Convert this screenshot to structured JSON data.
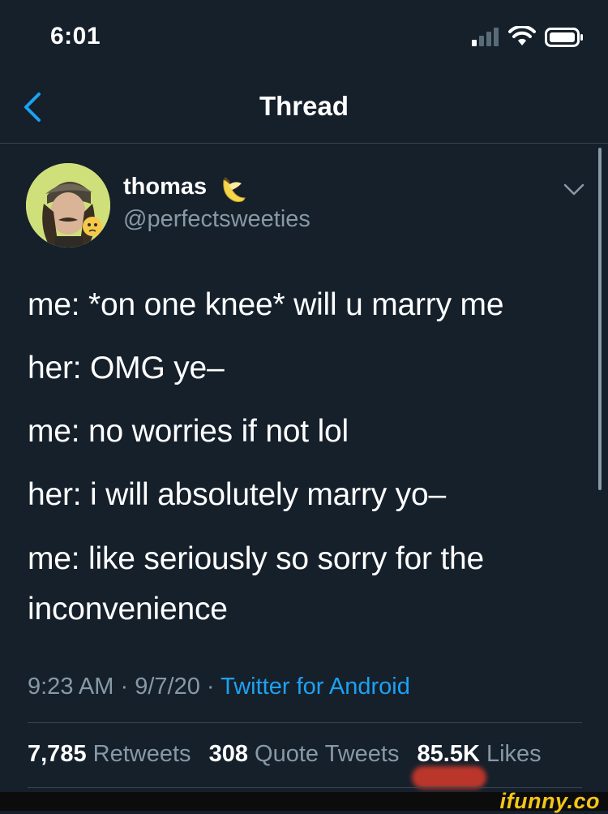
{
  "status_bar": {
    "time": "6:01",
    "icons": [
      "cellular-signal-icon",
      "wifi-icon",
      "battery-icon"
    ]
  },
  "nav": {
    "title": "Thread",
    "back_icon": "chevron-left-icon"
  },
  "tweet": {
    "author": {
      "display_name": "thomas",
      "emoji": "banana",
      "handle": "@perfectsweeties"
    },
    "text_lines": [
      "me: *on one knee* will u marry me",
      "her: OMG ye–",
      "me: no worries if not lol",
      "her: i will absolutely marry yo–",
      "me: like seriously so sorry for the inconvenience"
    ],
    "time": "9:23 AM",
    "date": "9/7/20",
    "separator": "·",
    "source": "Twitter for Android",
    "stats": {
      "retweets_count": "7,785",
      "retweets_label": "Retweets",
      "quotes_count": "308",
      "quotes_label": "Quote Tweets",
      "likes_count": "85.5K",
      "likes_label": "Likes"
    }
  },
  "watermark": "ifunny.co",
  "colors": {
    "background": "#15202b",
    "accent": "#1da1f2",
    "muted": "#8899a6",
    "divider": "#38444d"
  }
}
